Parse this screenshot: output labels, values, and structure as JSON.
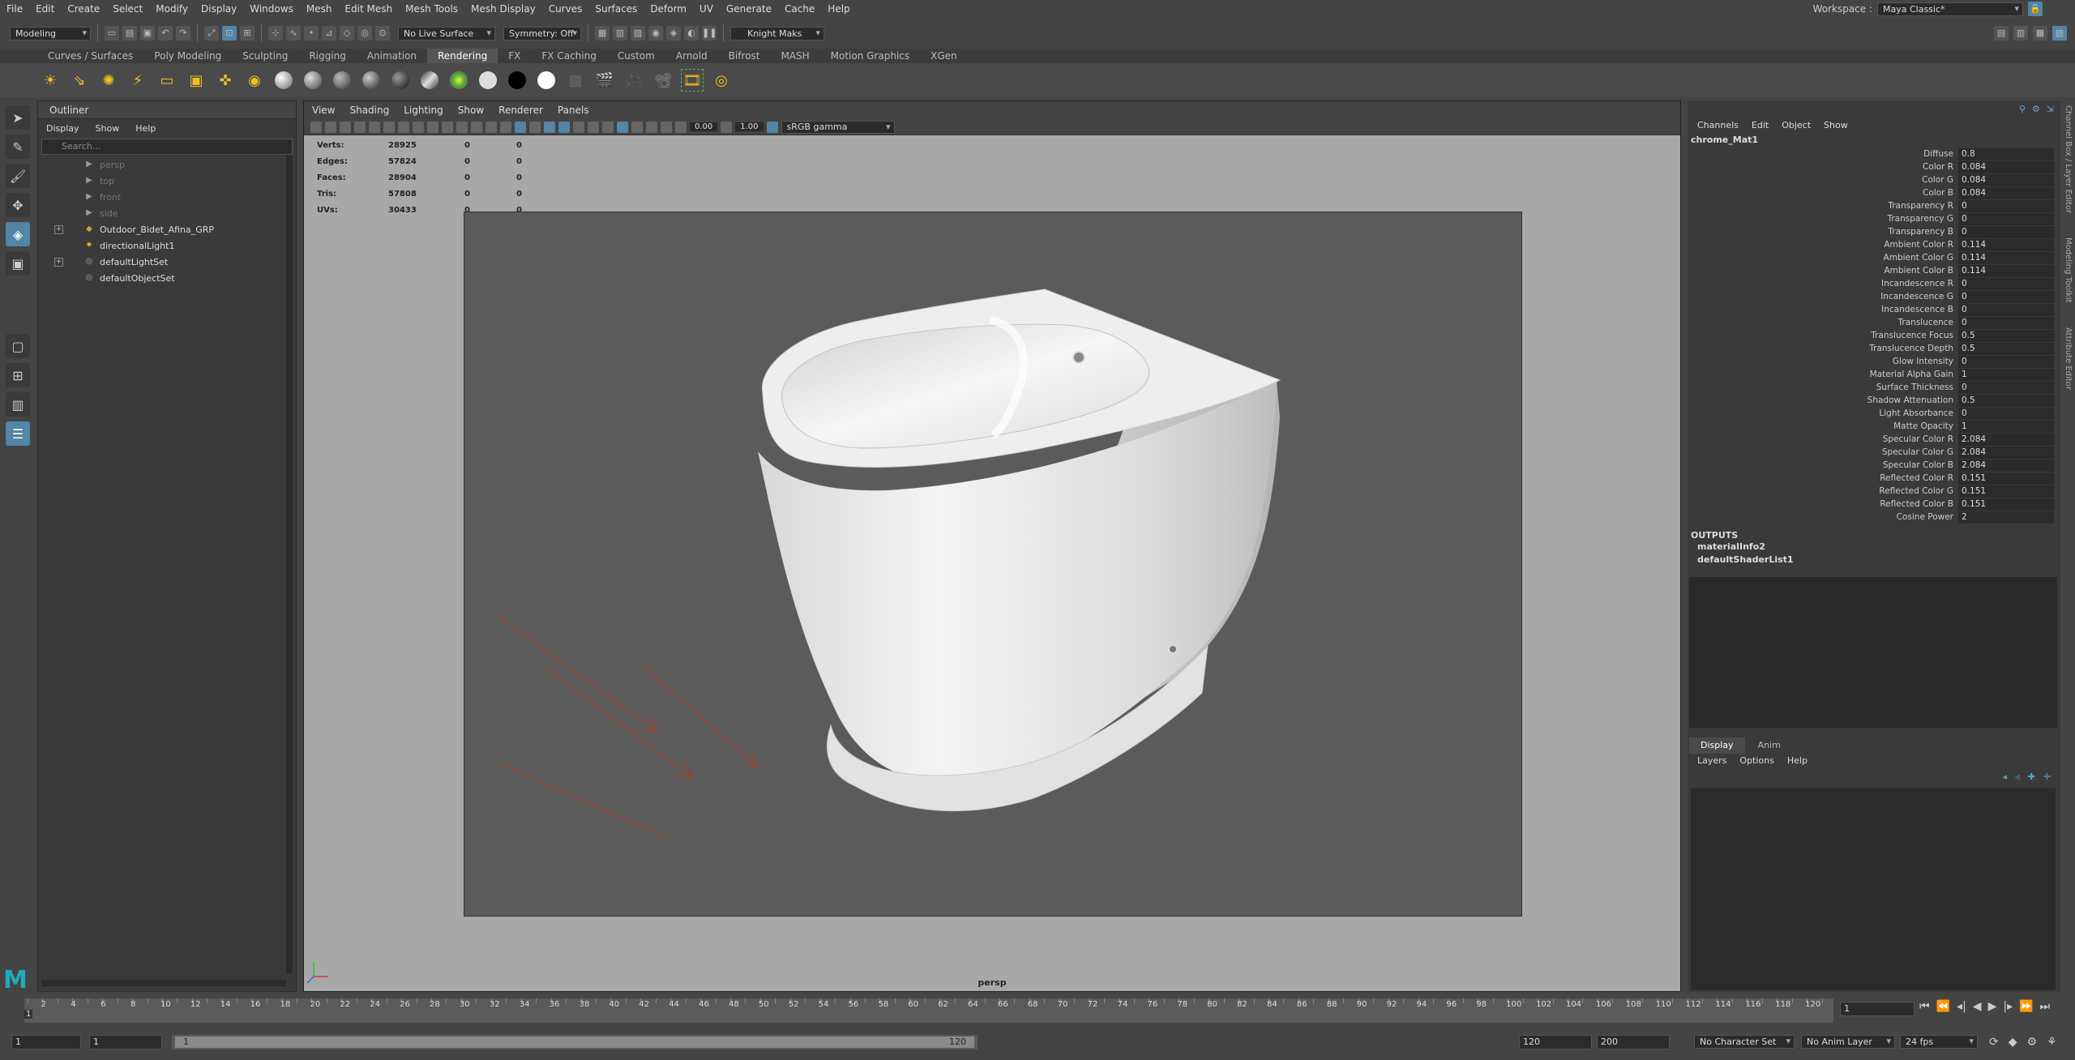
{
  "menubar": [
    "File",
    "Edit",
    "Create",
    "Select",
    "Modify",
    "Display",
    "Windows",
    "Mesh",
    "Edit Mesh",
    "Mesh Tools",
    "Mesh Display",
    "Curves",
    "Surfaces",
    "Deform",
    "UV",
    "Generate",
    "Cache",
    "Help"
  ],
  "workspace": {
    "label": "Workspace :",
    "value": "Maya Classic*"
  },
  "statusline": {
    "mode": "Modeling",
    "live_surface": "No Live Surface",
    "symmetry": "Symmetry: Off",
    "user": "Knight Maks"
  },
  "shelf_tabs": [
    "Curves / Surfaces",
    "Poly Modeling",
    "Sculpting",
    "Rigging",
    "Animation",
    "Rendering",
    "FX",
    "FX Caching",
    "Custom",
    "Arnold",
    "Bifrost",
    "MASH",
    "Motion Graphics",
    "XGen"
  ],
  "shelf_active": "Rendering",
  "outliner": {
    "title": "Outliner",
    "menu": [
      "Display",
      "Show",
      "Help"
    ],
    "search_placeholder": "Search...",
    "items": [
      {
        "label": "persp",
        "dim": true,
        "icon": "camera-icon"
      },
      {
        "label": "top",
        "dim": true,
        "icon": "camera-icon"
      },
      {
        "label": "front",
        "dim": true,
        "icon": "camera-icon"
      },
      {
        "label": "side",
        "dim": true,
        "icon": "camera-icon"
      },
      {
        "label": "Outdoor_Bidet_Afina_GRP",
        "dim": false,
        "icon": "group-icon",
        "expand": true
      },
      {
        "label": "directionalLight1",
        "dim": false,
        "icon": "light-icon"
      },
      {
        "label": "defaultLightSet",
        "dim": false,
        "icon": "set-icon",
        "expand": true
      },
      {
        "label": "defaultObjectSet",
        "dim": false,
        "icon": "set-icon"
      }
    ]
  },
  "viewport": {
    "menu": [
      "View",
      "Shading",
      "Lighting",
      "Show",
      "Renderer",
      "Panels"
    ],
    "exposure": "0.00",
    "gamma": "1.00",
    "colorspace": "sRGB gamma",
    "hud": [
      {
        "label": "Verts:",
        "v1": "28925",
        "v2": "0",
        "v3": "0"
      },
      {
        "label": "Edges:",
        "v1": "57824",
        "v2": "0",
        "v3": "0"
      },
      {
        "label": "Faces:",
        "v1": "28904",
        "v2": "0",
        "v3": "0"
      },
      {
        "label": "Tris:",
        "v1": "57808",
        "v2": "0",
        "v3": "0"
      },
      {
        "label": "UVs:",
        "v1": "30433",
        "v2": "0",
        "v3": "0"
      }
    ],
    "camera": "persp"
  },
  "channelbox": {
    "menu": [
      "Channels",
      "Edit",
      "Object",
      "Show"
    ],
    "object": "chrome_Mat1",
    "channels": [
      {
        "name": "Diffuse",
        "value": "0.8"
      },
      {
        "name": "Color R",
        "value": "0.084"
      },
      {
        "name": "Color G",
        "value": "0.084"
      },
      {
        "name": "Color B",
        "value": "0.084"
      },
      {
        "name": "Transparency R",
        "value": "0"
      },
      {
        "name": "Transparency G",
        "value": "0"
      },
      {
        "name": "Transparency B",
        "value": "0"
      },
      {
        "name": "Ambient Color R",
        "value": "0.114"
      },
      {
        "name": "Ambient Color G",
        "value": "0.114"
      },
      {
        "name": "Ambient Color B",
        "value": "0.114"
      },
      {
        "name": "Incandescence R",
        "value": "0"
      },
      {
        "name": "Incandescence G",
        "value": "0"
      },
      {
        "name": "Incandescence B",
        "value": "0"
      },
      {
        "name": "Translucence",
        "value": "0"
      },
      {
        "name": "Translucence Focus",
        "value": "0.5"
      },
      {
        "name": "Translucence Depth",
        "value": "0.5"
      },
      {
        "name": "Glow Intensity",
        "value": "0"
      },
      {
        "name": "Material Alpha Gain",
        "value": "1"
      },
      {
        "name": "Surface Thickness",
        "value": "0"
      },
      {
        "name": "Shadow Attenuation",
        "value": "0.5"
      },
      {
        "name": "Light Absorbance",
        "value": "0"
      },
      {
        "name": "Matte Opacity",
        "value": "1"
      },
      {
        "name": "Specular Color R",
        "value": "2.084"
      },
      {
        "name": "Specular Color G",
        "value": "2.084"
      },
      {
        "name": "Specular Color B",
        "value": "2.084"
      },
      {
        "name": "Reflected Color R",
        "value": "0.151"
      },
      {
        "name": "Reflected Color G",
        "value": "0.151"
      },
      {
        "name": "Reflected Color B",
        "value": "0.151"
      },
      {
        "name": "Cosine Power",
        "value": "2"
      }
    ],
    "outputs_label": "OUTPUTS",
    "outputs": [
      "materialInfo2",
      "defaultShaderList1"
    ],
    "layer_tabs": [
      "Display",
      "Anim"
    ],
    "layer_menu": [
      "Layers",
      "Options",
      "Help"
    ],
    "side_tabs": [
      "Channel Box / Layer Editor",
      "Modeling Toolkit",
      "Attribute Editor"
    ]
  },
  "timeline": {
    "ticks": [
      "2",
      "4",
      "6",
      "8",
      "10",
      "12",
      "14",
      "16",
      "18",
      "20",
      "22",
      "24",
      "26",
      "28",
      "30",
      "32",
      "34",
      "36",
      "38",
      "40",
      "42",
      "44",
      "46",
      "48",
      "50",
      "52",
      "54",
      "56",
      "58",
      "60",
      "62",
      "64",
      "66",
      "68",
      "70",
      "72",
      "74",
      "76",
      "78",
      "80",
      "82",
      "84",
      "86",
      "88",
      "90",
      "92",
      "94",
      "96",
      "98",
      "100",
      "102",
      "104",
      "106",
      "108",
      "110",
      "112",
      "114",
      "116",
      "118",
      "120"
    ],
    "start_marker": "1",
    "current_frame": "1"
  },
  "range": {
    "start": "1",
    "inner_start": "1",
    "range_start": "1",
    "range_end": "120",
    "end": "120",
    "anim_end": "200",
    "character_set": "No Character Set",
    "anim_layer": "No Anim Layer",
    "fps": "24 fps"
  }
}
